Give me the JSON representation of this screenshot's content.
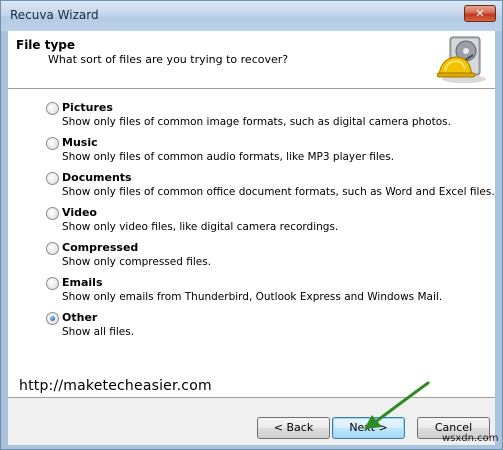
{
  "window": {
    "title": "Recuva Wizard",
    "close_label": "✕"
  },
  "header": {
    "title": "File type",
    "subtitle": "What sort of files are you trying to recover?",
    "icon": "hard-drive-hardhat-icon"
  },
  "options": [
    {
      "label": "Pictures",
      "description": "Show only files of common image formats, such as digital camera photos.",
      "checked": false
    },
    {
      "label": "Music",
      "description": "Show only files of common audio formats, like MP3 player files.",
      "checked": false
    },
    {
      "label": "Documents",
      "description": "Show only files of common office document formats, such as Word and Excel files.",
      "checked": false
    },
    {
      "label": "Video",
      "description": "Show only video files, like digital camera recordings.",
      "checked": false
    },
    {
      "label": "Compressed",
      "description": "Show only compressed files.",
      "checked": false
    },
    {
      "label": "Emails",
      "description": "Show only emails from Thunderbird, Outlook Express and Windows Mail.",
      "checked": false
    },
    {
      "label": "Other",
      "description": "Show all files.",
      "checked": true
    }
  ],
  "watermark_url": "http://maketecheasier.com",
  "buttons": {
    "back": "< Back",
    "next": "Next >",
    "cancel": "Cancel"
  },
  "corner_watermark": "wsxdn.com",
  "annotation": {
    "icon": "green-arrow-icon",
    "color": "#2e8b23"
  }
}
